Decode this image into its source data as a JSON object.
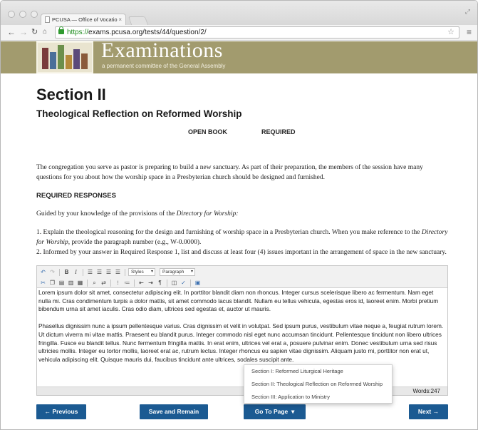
{
  "browser": {
    "tab_title": "PCUSA — Office of Vocatio",
    "tab_close": "×",
    "url_scheme": "https://",
    "url_host": "exams.pcusa.org",
    "url_path": "/tests/44/question/2/"
  },
  "banner": {
    "title": "Examinations",
    "subtitle": "a permanent committee of the General Assembly"
  },
  "page": {
    "section_title": "Section II",
    "section_subtitle": "Theological Reflection on Reformed Worship",
    "tag_open_book": "OPEN BOOK",
    "tag_required": "REQUIRED",
    "intro": "The congregation you serve as pastor is preparing to build a new sanctuary.  As part of their preparation, the members of the session have many questions for you about how the worship space in a Presbyterian church should be designed and furnished.",
    "required_heading": "REQUIRED RESPONSES",
    "guided_pre": "Guided by your knowledge of the provisions of the ",
    "guided_book": "Directory for Worship:",
    "item1_pre": "1. Explain the theological reasoning for the design and furnishing of worship space in a Presbyterian church. When you make reference to the ",
    "item1_book": "Directory for Worship",
    "item1_post": ", provide the paragraph number (e.g., W-0.0000).",
    "item2": "2. Informed by your answer in Required Response 1, list and discuss at least four (4) issues important in the arrangement of space in the new sanctuary."
  },
  "editor": {
    "styles_label": "Styles",
    "paragraph_label": "Paragraph",
    "para1": "Lorem ipsum dolor sit amet, consectetur adipiscing elit. In porttitor blandit diam non rhoncus. Integer cursus scelerisque libero ac fermentum. Nam eget nulla mi. Cras condimentum turpis a dolor mattis, sit amet commodo lacus blandit. Nullam eu tellus vehicula, egestas eros id, laoreet enim. Morbi pretium bibendum urna sit amet iaculis. Cras odio diam, ultrices sed egestas et, auctor ut mauris.",
    "para2": "Phasellus dignissim nunc a ipsum pellentesque varius. Cras dignissim et velit in volutpat. Sed ipsum purus, vestibulum vitae neque a, feugiat rutrum lorem. Ut dictum viverra mi vitae mattis. Praesent eu blandit purus. Integer commodo nisl eget nunc accumsan tincidunt. Pellentesque tincidunt non libero ultrices fringilla. Fusce eu blandit tellus. Nunc fermentum fringilla mattis. In erat enim, ultrices vel erat a, posuere pulvinar enim. Donec vestibulum urna sed risus ultricies mollis. Integer eu tortor mollis, laoreet erat ac, rutrum lectus. Integer rhoncus eu sapien vitae dignissim. Aliquam justo mi, porttitor non erat ut, vehicula adipiscing elit. Quisque mauris dui, faucibus tincidunt ante ultrices, sodales suscipit ante.",
    "word_count": "Words:247"
  },
  "buttons": {
    "previous": "← Previous",
    "save": "Save and Remain",
    "goto": "Go To Page",
    "next": "Next →"
  },
  "goto_menu": [
    "Section I: Reformed Liturgical Heritage",
    "Section II: Theological Reflection on Reformed Worship",
    "Section III: Application to Ministry"
  ],
  "colors": {
    "banner": "#a29b6e",
    "button": "#1b5a92",
    "url_host": "#1c8c1c"
  }
}
